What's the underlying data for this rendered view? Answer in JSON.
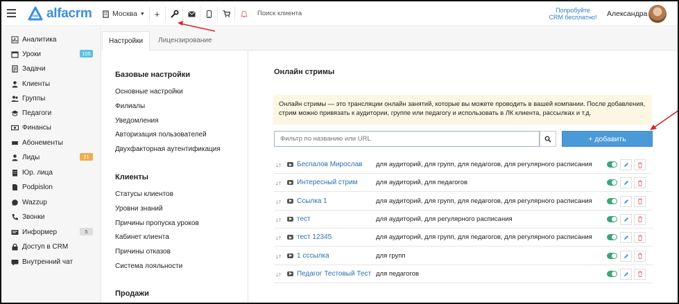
{
  "topbar": {
    "logo_text": "alfacrm",
    "city": "Москва",
    "search_placeholder": "Поиск клиента",
    "trial_line1": "Попробуйте",
    "trial_line2": "CRM бесплатно!",
    "user_name": "Александра",
    "icons": [
      "plus-icon",
      "wrench-icon",
      "mail-icon",
      "phone-icon",
      "cart-icon",
      "bell-icon"
    ]
  },
  "sidebar": {
    "items": [
      {
        "label": "Аналитика",
        "icon": "analytics-icon"
      },
      {
        "label": "Уроки",
        "icon": "calendar-icon",
        "badge": "105",
        "badge_color": "#5bc0de"
      },
      {
        "label": "Задачи",
        "icon": "tasks-icon"
      },
      {
        "label": "Клиенты",
        "icon": "user-icon"
      },
      {
        "label": "Группы",
        "icon": "users-icon"
      },
      {
        "label": "Педагоги",
        "icon": "graduation-cap-icon"
      },
      {
        "label": "Финансы",
        "icon": "money-icon"
      },
      {
        "label": "Абонементы",
        "icon": "ticket-icon"
      },
      {
        "label": "Лиды",
        "icon": "leads-icon",
        "badge": "21",
        "badge_color": "#f0ad4e"
      },
      {
        "label": "Юр. лица",
        "icon": "building-icon"
      },
      {
        "label": "Podpislon",
        "icon": "document-icon"
      },
      {
        "label": "Wazzup",
        "icon": "whatsapp-icon"
      },
      {
        "label": "Звонки",
        "icon": "phone-icon"
      },
      {
        "label": "Информер",
        "icon": "informer-icon",
        "badge": "5",
        "badge_color": "#dddddd"
      },
      {
        "label": "Доступ в CRM",
        "icon": "lock-icon"
      },
      {
        "label": "Внутренний чат",
        "icon": "chat-icon"
      }
    ]
  },
  "tabs": [
    {
      "label": "Настройки",
      "active": true
    },
    {
      "label": "Лицензирование",
      "active": false
    }
  ],
  "settings_menu": {
    "sections": [
      {
        "title": "Базовые настройки",
        "links": [
          "Основные настройки",
          "Филиалы",
          "Уведомления",
          "Авторизация пользователей",
          "Двухфакторная аутентификация"
        ]
      },
      {
        "title": "Клиенты",
        "links": [
          "Статусы клиентов",
          "Уровни знаний",
          "Причины пропуска уроков",
          "Кабинет клиента",
          "Причины отказов",
          "Система лояльности"
        ]
      },
      {
        "title": "Продажи",
        "links": []
      }
    ]
  },
  "main": {
    "title": "Онлайн стримы",
    "info": "Онлайн стримы — это трансляции онлайн занятий, которые вы можете проводить в вашей компании. После добавления, стрим можно привязать к аудитории, группе или педагогу и использовать в ЛК клиента, рассылках и т.д.",
    "filter_placeholder": "Фильтр по названию или URL",
    "add_button": "+ добавить",
    "streams": [
      {
        "name": "Беспалов Мирослав",
        "desc": "для аудиторий, для групп, для педагогов, для регулярного расписания",
        "enabled": true
      },
      {
        "name": "Интересный стрим",
        "desc": "для аудиторий, для педагогов",
        "enabled": true
      },
      {
        "name": "Ссылка 1",
        "desc": "для аудиторий, для групп, для педагогов, для регулярного расписания",
        "enabled": true
      },
      {
        "name": "тест",
        "desc": "для аудиторий, для регулярного расписания",
        "enabled": true
      },
      {
        "name": "тест 12345",
        "desc": "для аудиторий, для групп, для педагогов, для регулярного расписания",
        "enabled": true
      },
      {
        "name": "1 сссылка",
        "desc": "для групп",
        "enabled": true
      },
      {
        "name": "Педагог Тестовый Тест",
        "desc": "для педагогов",
        "enabled": true
      }
    ]
  },
  "colors": {
    "accent": "#3a8fd9",
    "add_button": "#4a9ad8",
    "toggle_on": "#3aa778",
    "info_bg": "#fdf6e3",
    "annotation_arrow": "#d9262b"
  }
}
